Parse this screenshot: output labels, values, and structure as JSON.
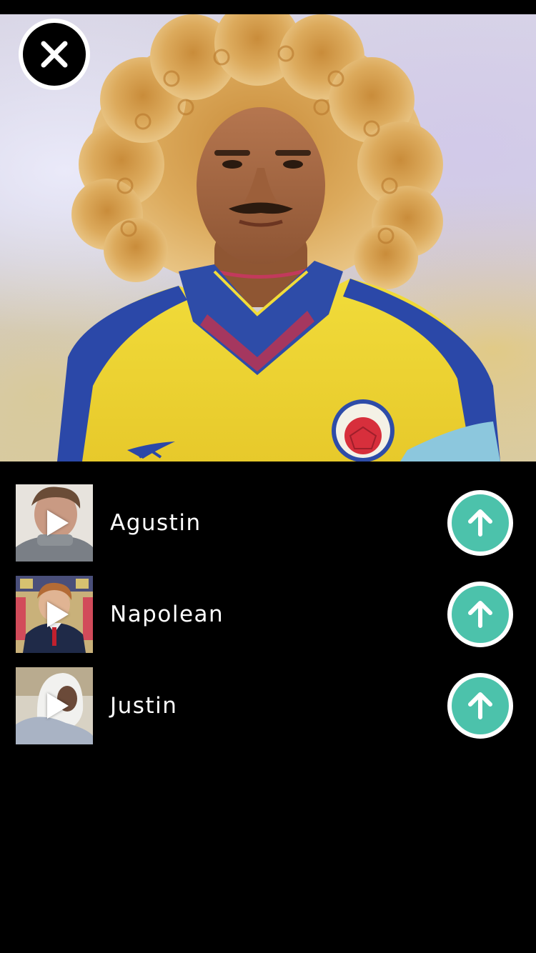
{
  "header": {
    "close_icon": "close-icon"
  },
  "hero": {
    "content": "photo"
  },
  "contacts": [
    {
      "name": "Agustin",
      "action_icon": "arrow-up-icon",
      "thumb_icon": "play-icon"
    },
    {
      "name": "Napolean",
      "action_icon": "arrow-up-icon",
      "thumb_icon": "play-icon"
    },
    {
      "name": "Justin",
      "action_icon": "arrow-up-icon",
      "thumb_icon": "play-icon"
    }
  ],
  "colors": {
    "background": "#000000",
    "accent": "#4cc2ab",
    "text": "#ffffff"
  }
}
